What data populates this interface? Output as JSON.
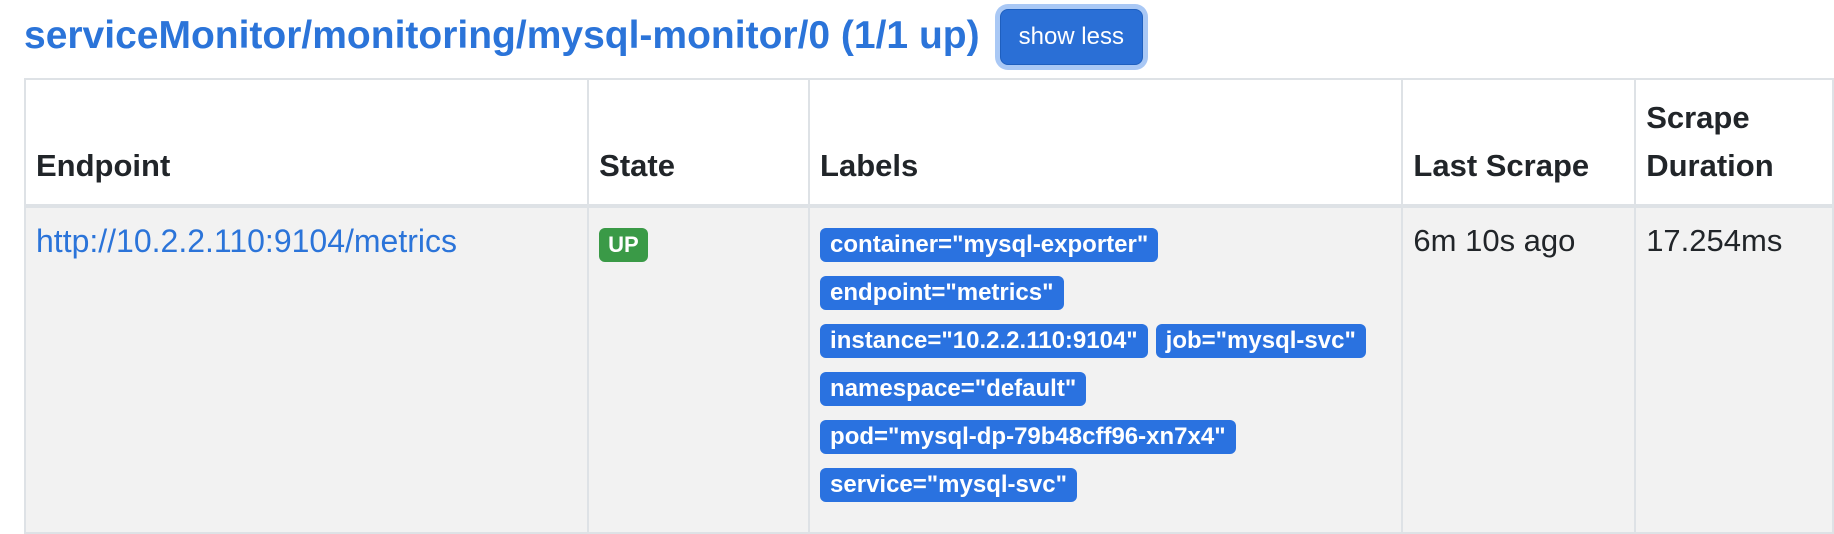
{
  "header": {
    "title": "serviceMonitor/monitoring/mysql-monitor/0 (1/1 up)",
    "toggle_label": "show less"
  },
  "table": {
    "columns": [
      "Endpoint",
      "State",
      "Labels",
      "Last Scrape",
      "Scrape Duration"
    ],
    "rows": [
      {
        "endpoint": "http://10.2.2.110:9104/metrics",
        "state": "UP",
        "labels": [
          "container=\"mysql-exporter\"",
          "endpoint=\"metrics\"",
          "instance=\"10.2.2.110:9104\"",
          "job=\"mysql-svc\"",
          "namespace=\"default\"",
          "pod=\"mysql-dp-79b48cff96-xn7x4\"",
          "service=\"mysql-svc\""
        ],
        "last_scrape": "6m 10s ago",
        "scrape_duration": "17.254ms"
      }
    ]
  },
  "colors": {
    "link": "#2b74d9",
    "button": "#2a6fd6",
    "state_up": "#3a9a47",
    "label_badge": "#2a72e0",
    "row_bg": "#f2f2f2"
  }
}
